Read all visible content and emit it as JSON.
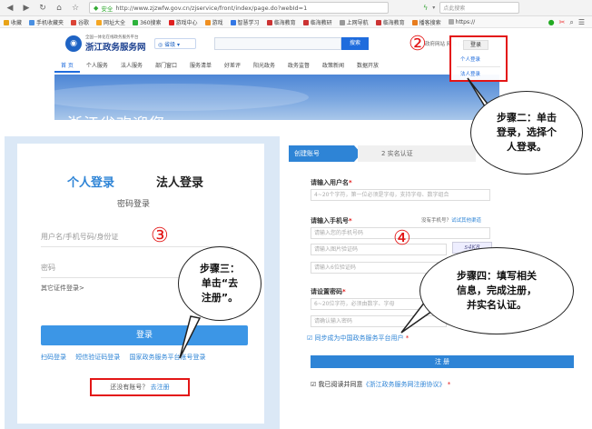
{
  "browser": {
    "url_security": "安全",
    "url": "http://www.zjzwfw.gov.cn/zjservice/front/index/page.do?webId=1",
    "search_placeholder": "点此搜索",
    "nav_icons": [
      "back-icon",
      "forward-icon",
      "reload-icon",
      "home-icon",
      "star-icon"
    ],
    "bookmarks": [
      "收藏",
      "手机收藏夹",
      "谷歌",
      "网址大全",
      "360搜索",
      "游戏中心",
      "游戏",
      "智慧学习",
      "临海教育",
      "临海教研",
      "上网导航",
      "临海教育",
      "播客搜索",
      "https://"
    ]
  },
  "header": {
    "logo_sub": "全国一体化在线政务服务平台",
    "logo_main": "浙江政务服务网",
    "city": "◎ 省级 ▾",
    "search_button": "搜索",
    "links": "政府网站 网站  |  工作台"
  },
  "nav": {
    "items": [
      "首 页",
      "个人服务",
      "法人服务",
      "部门窗口",
      "服务清单",
      "好差评",
      "阳光政务",
      "政务监督",
      "政策新闻",
      "数据开放"
    ]
  },
  "hero": {
    "title": "浙江省欢迎您"
  },
  "login_dropdown": {
    "button": "登录",
    "options": [
      "个人登录",
      "法人登录"
    ]
  },
  "steps": {
    "step2_num": "②",
    "step3_num": "③",
    "step4_num": "④"
  },
  "login_card": {
    "tab_personal": "个人登录",
    "tab_legal": "法人登录",
    "mode": "密码登录",
    "username_placeholder": "用户名/手机号码/身份证",
    "password_placeholder": "密码",
    "other_cert": "其它证件登录>",
    "submit": "登录",
    "alt_links": [
      "扫码登录",
      "短信验证码登录",
      "国家政务服务平台账号登录"
    ],
    "no_account": "还没有账号？",
    "go_register": "去注册"
  },
  "registration": {
    "step1": "创建账号",
    "step2": "2 实名认证",
    "username_label": "请输入用户名",
    "username_placeholder": "4~20个字符，第一位必须是字母，支持字母、数字组合",
    "phone_label": "请输入手机号",
    "phone_note_prefix": "没有手机号？",
    "phone_note_link": "试试其他渠道",
    "phone_placeholder": "请输入您的手机号码",
    "image_code_placeholder": "请输入图片验证码",
    "sms_code_placeholder": "请输入6位验证码",
    "password_label": "请设置密码",
    "password_placeholder": "6~20位字符，必须由数字、字母",
    "confirm_placeholder": "请确认输入密码",
    "sync_label": "同步成为中国政务服务平台用户",
    "register_button": "注 册",
    "agree_prefix": "我已阅读并同意",
    "agree_link": "《浙江政务服务网注册协议》",
    "required_mark": "*",
    "captcha": "s4K8"
  },
  "callouts": {
    "step2": [
      "步骤二：单击",
      "登录，选择个",
      "人登录。"
    ],
    "step3": [
      "步骤三：",
      "单击“去",
      "注册”。"
    ],
    "step4": [
      "步骤四：填写相关",
      "信息，完成注册，",
      "并实名认证。"
    ]
  }
}
